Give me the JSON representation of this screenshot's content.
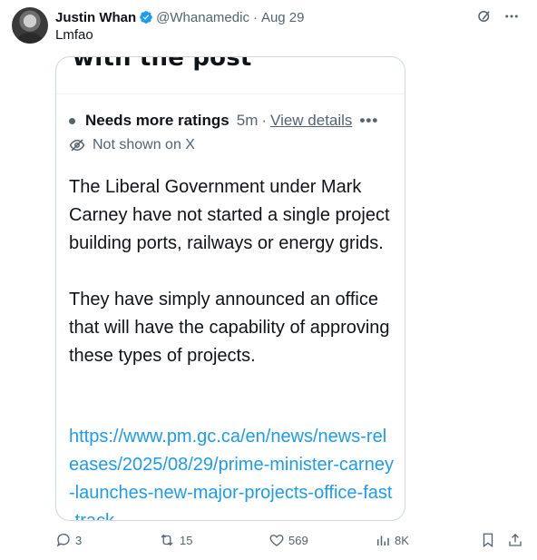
{
  "tweet": {
    "author_name": "Justin Whan",
    "handle": "@Whanamedic",
    "separator": "·",
    "date": "Aug 29",
    "text": "Lmfao"
  },
  "media": {
    "heading_fragment": "with the post",
    "note_status": "Needs more ratings",
    "note_time": "5m",
    "note_separator": "·",
    "view_details": "View details",
    "more_label": "•••",
    "not_shown": "Not shown on X",
    "paragraph_1": "The Liberal Government under Mark Carney have not started a single project building ports, railways or energy grids.",
    "paragraph_2": "They have simply announced an office that will have the capability of approving these types of projects.",
    "link": "https://www.pm.gc.ca/en/news/news-releases/2025/08/29/prime-minister-carney-launches-new-major-projects-office-fast-track"
  },
  "actions": {
    "replies": "3",
    "reposts": "15",
    "likes": "569",
    "views": "8K"
  },
  "colors": {
    "accent": "#1d9bf0",
    "muted": "#536471",
    "text": "#0f1419",
    "border": "#cfd9de"
  }
}
